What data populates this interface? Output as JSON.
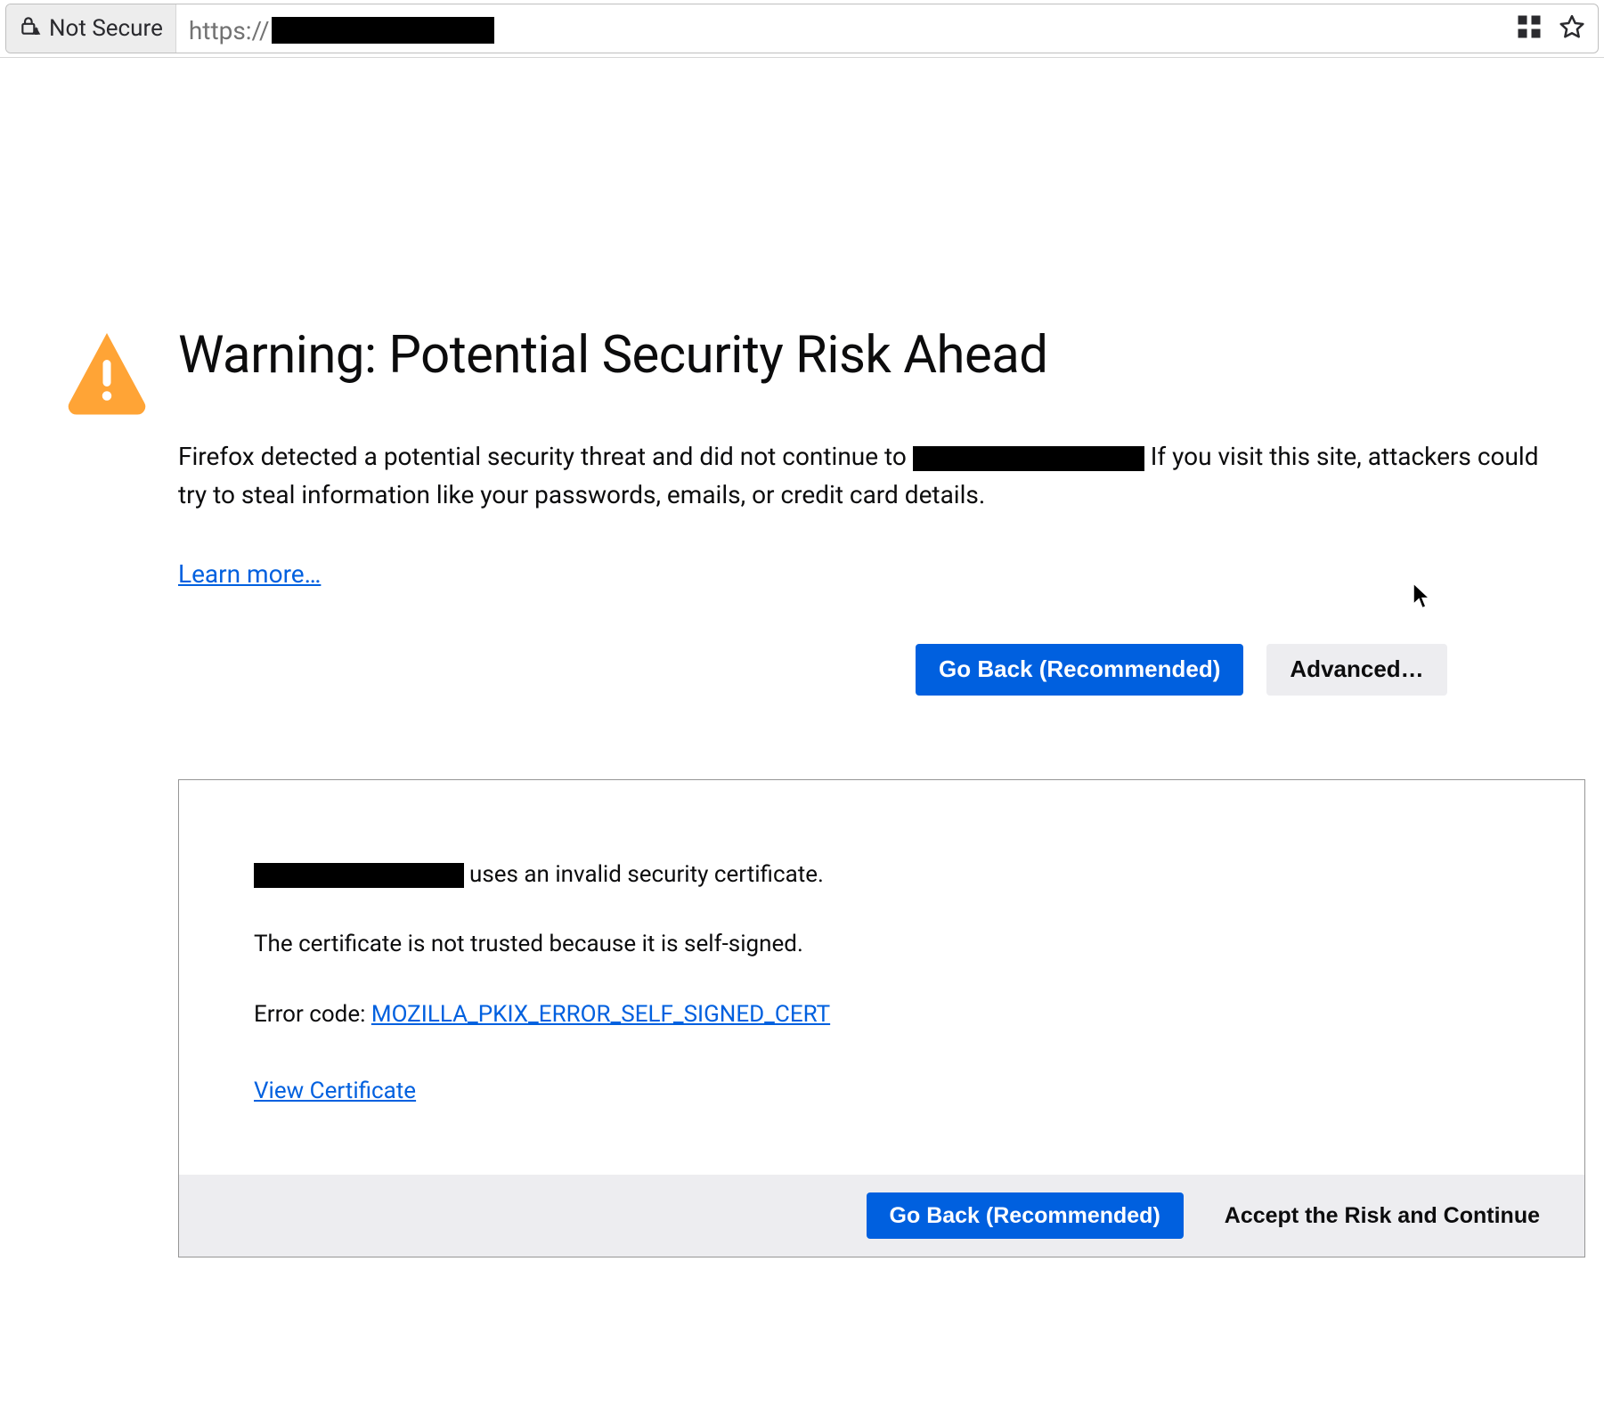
{
  "address_bar": {
    "security_label": "Not Secure",
    "url_scheme": "https://"
  },
  "page": {
    "title": "Warning: Potential Security Risk Ahead",
    "desc_prefix": "Firefox detected a potential security threat and did not continue to ",
    "desc_suffix": " If you visit this site, attackers could try to steal information like your passwords, emails, or credit card details.",
    "learn_more": "Learn more…",
    "go_back": "Go Back (Recommended)",
    "advanced": "Advanced…"
  },
  "panel": {
    "line1_suffix": "uses an invalid security certificate.",
    "line2": "The certificate is not trusted because it is self-signed.",
    "error_label": "Error code: ",
    "error_code": "MOZILLA_PKIX_ERROR_SELF_SIGNED_CERT",
    "view_cert": "View Certificate",
    "go_back": "Go Back (Recommended)",
    "accept": "Accept the Risk and Continue"
  }
}
